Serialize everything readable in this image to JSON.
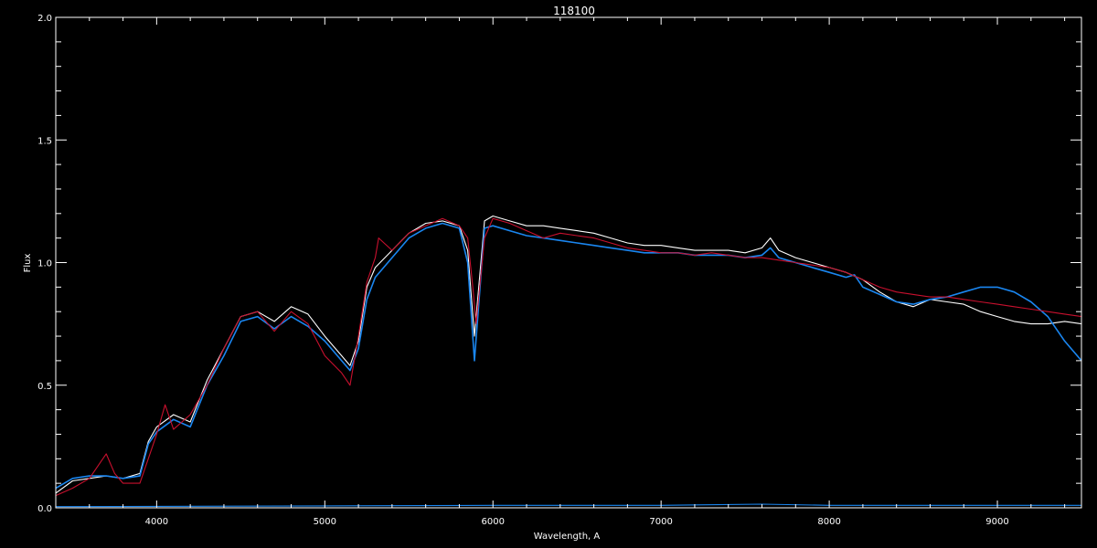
{
  "chart_data": {
    "type": "line",
    "title": "118100",
    "xlabel": "Wavelength, A",
    "ylabel": "Flux",
    "xlim": [
      3400,
      9500
    ],
    "ylim": [
      0.0,
      2.0
    ],
    "x_ticks": [
      4000,
      5000,
      6000,
      7000,
      8000,
      9000
    ],
    "x_tick_labels": [
      "4000",
      "5000",
      "6000",
      "7000",
      "8000",
      "9000"
    ],
    "y_ticks": [
      0.0,
      0.5,
      1.0,
      1.5,
      2.0
    ],
    "y_tick_labels": [
      "0.0",
      "0.5",
      "1.0",
      "1.5",
      "2.0"
    ],
    "grid": false,
    "colors": {
      "background": "#000000",
      "axes": "#ffffff",
      "observed": "#ffffff",
      "model": "#1a86f0",
      "smooth": "#c8102e",
      "error": "#1a86f0"
    },
    "series": [
      {
        "key": "observed",
        "color": "#ffffff",
        "x": [
          3400,
          3500,
          3600,
          3700,
          3800,
          3900,
          3950,
          4000,
          4100,
          4200,
          4300,
          4400,
          4500,
          4600,
          4700,
          4800,
          4900,
          5000,
          5100,
          5150,
          5200,
          5250,
          5300,
          5400,
          5500,
          5600,
          5700,
          5800,
          5850,
          5890,
          5950,
          6000,
          6100,
          6200,
          6300,
          6400,
          6500,
          6600,
          6700,
          6800,
          6900,
          7000,
          7100,
          7200,
          7300,
          7400,
          7500,
          7600,
          7650,
          7700,
          7800,
          7900,
          8000,
          8100,
          8200,
          8300,
          8400,
          8500,
          8600,
          8700,
          8800,
          8900,
          9000,
          9100,
          9200,
          9300,
          9400,
          9500
        ],
        "y": [
          0.06,
          0.11,
          0.12,
          0.13,
          0.12,
          0.14,
          0.27,
          0.33,
          0.38,
          0.35,
          0.52,
          0.65,
          0.78,
          0.8,
          0.76,
          0.82,
          0.79,
          0.7,
          0.62,
          0.58,
          0.68,
          0.9,
          0.98,
          1.05,
          1.12,
          1.16,
          1.17,
          1.15,
          1.05,
          0.7,
          1.17,
          1.19,
          1.17,
          1.15,
          1.15,
          1.14,
          1.13,
          1.12,
          1.1,
          1.08,
          1.07,
          1.07,
          1.06,
          1.05,
          1.05,
          1.05,
          1.04,
          1.06,
          1.1,
          1.05,
          1.02,
          1.0,
          0.98,
          0.96,
          0.93,
          0.88,
          0.84,
          0.82,
          0.85,
          0.84,
          0.83,
          0.8,
          0.78,
          0.76,
          0.75,
          0.75,
          0.76,
          0.75
        ]
      },
      {
        "key": "model",
        "color": "#1a86f0",
        "x": [
          3400,
          3500,
          3600,
          3700,
          3800,
          3900,
          3950,
          4000,
          4100,
          4200,
          4300,
          4400,
          4500,
          4600,
          4700,
          4800,
          4900,
          5000,
          5100,
          5150,
          5200,
          5250,
          5300,
          5400,
          5500,
          5600,
          5700,
          5800,
          5850,
          5890,
          5950,
          6000,
          6100,
          6200,
          6300,
          6400,
          6500,
          6600,
          6700,
          6800,
          6900,
          7000,
          7100,
          7200,
          7300,
          7400,
          7500,
          7600,
          7650,
          7700,
          7800,
          7900,
          8000,
          8100,
          8150,
          8200,
          8300,
          8400,
          8500,
          8600,
          8700,
          8800,
          8900,
          9000,
          9100,
          9200,
          9300,
          9400,
          9500
        ],
        "y": [
          0.08,
          0.12,
          0.13,
          0.13,
          0.12,
          0.13,
          0.26,
          0.31,
          0.36,
          0.33,
          0.5,
          0.62,
          0.76,
          0.78,
          0.73,
          0.78,
          0.74,
          0.68,
          0.6,
          0.56,
          0.65,
          0.85,
          0.94,
          1.02,
          1.1,
          1.14,
          1.16,
          1.14,
          1.0,
          0.6,
          1.14,
          1.15,
          1.13,
          1.11,
          1.1,
          1.09,
          1.08,
          1.07,
          1.06,
          1.05,
          1.04,
          1.04,
          1.04,
          1.03,
          1.03,
          1.03,
          1.02,
          1.03,
          1.06,
          1.02,
          1.0,
          0.98,
          0.96,
          0.94,
          0.95,
          0.9,
          0.87,
          0.84,
          0.83,
          0.85,
          0.86,
          0.88,
          0.9,
          0.9,
          0.88,
          0.84,
          0.78,
          0.68,
          0.6
        ]
      },
      {
        "key": "smooth",
        "color": "#c8102e",
        "x": [
          3400,
          3500,
          3600,
          3700,
          3750,
          3800,
          3900,
          3950,
          4000,
          4050,
          4100,
          4200,
          4300,
          4400,
          4500,
          4600,
          4700,
          4800,
          4900,
          5000,
          5100,
          5150,
          5200,
          5250,
          5300,
          5320,
          5400,
          5500,
          5600,
          5700,
          5800,
          5850,
          5880,
          5900,
          5950,
          6000,
          6100,
          6200,
          6300,
          6400,
          6500,
          6600,
          6700,
          6800,
          6900,
          7000,
          7100,
          7200,
          7300,
          7400,
          7500,
          7600,
          7700,
          7800,
          7900,
          8000,
          8100,
          8200,
          8300,
          8400,
          8500,
          8600,
          8700,
          8800,
          8900,
          9000,
          9100,
          9200,
          9300,
          9400,
          9500
        ],
        "y": [
          0.05,
          0.08,
          0.12,
          0.22,
          0.14,
          0.1,
          0.1,
          0.2,
          0.3,
          0.42,
          0.32,
          0.38,
          0.5,
          0.65,
          0.78,
          0.8,
          0.72,
          0.8,
          0.75,
          0.62,
          0.55,
          0.5,
          0.7,
          0.92,
          1.02,
          1.1,
          1.05,
          1.12,
          1.15,
          1.18,
          1.15,
          1.1,
          0.9,
          0.75,
          1.1,
          1.18,
          1.16,
          1.13,
          1.1,
          1.12,
          1.11,
          1.1,
          1.08,
          1.06,
          1.05,
          1.04,
          1.04,
          1.03,
          1.04,
          1.03,
          1.02,
          1.02,
          1.01,
          1.0,
          0.99,
          0.98,
          0.96,
          0.93,
          0.9,
          0.88,
          0.87,
          0.86,
          0.86,
          0.85,
          0.84,
          0.83,
          0.82,
          0.81,
          0.8,
          0.79,
          0.78
        ]
      },
      {
        "key": "error",
        "color": "#1a86f0",
        "x": [
          3400,
          4000,
          5000,
          6000,
          7000,
          7600,
          8000,
          9000,
          9500
        ],
        "y": [
          0.005,
          0.006,
          0.008,
          0.01,
          0.01,
          0.015,
          0.01,
          0.01,
          0.01
        ]
      }
    ]
  }
}
